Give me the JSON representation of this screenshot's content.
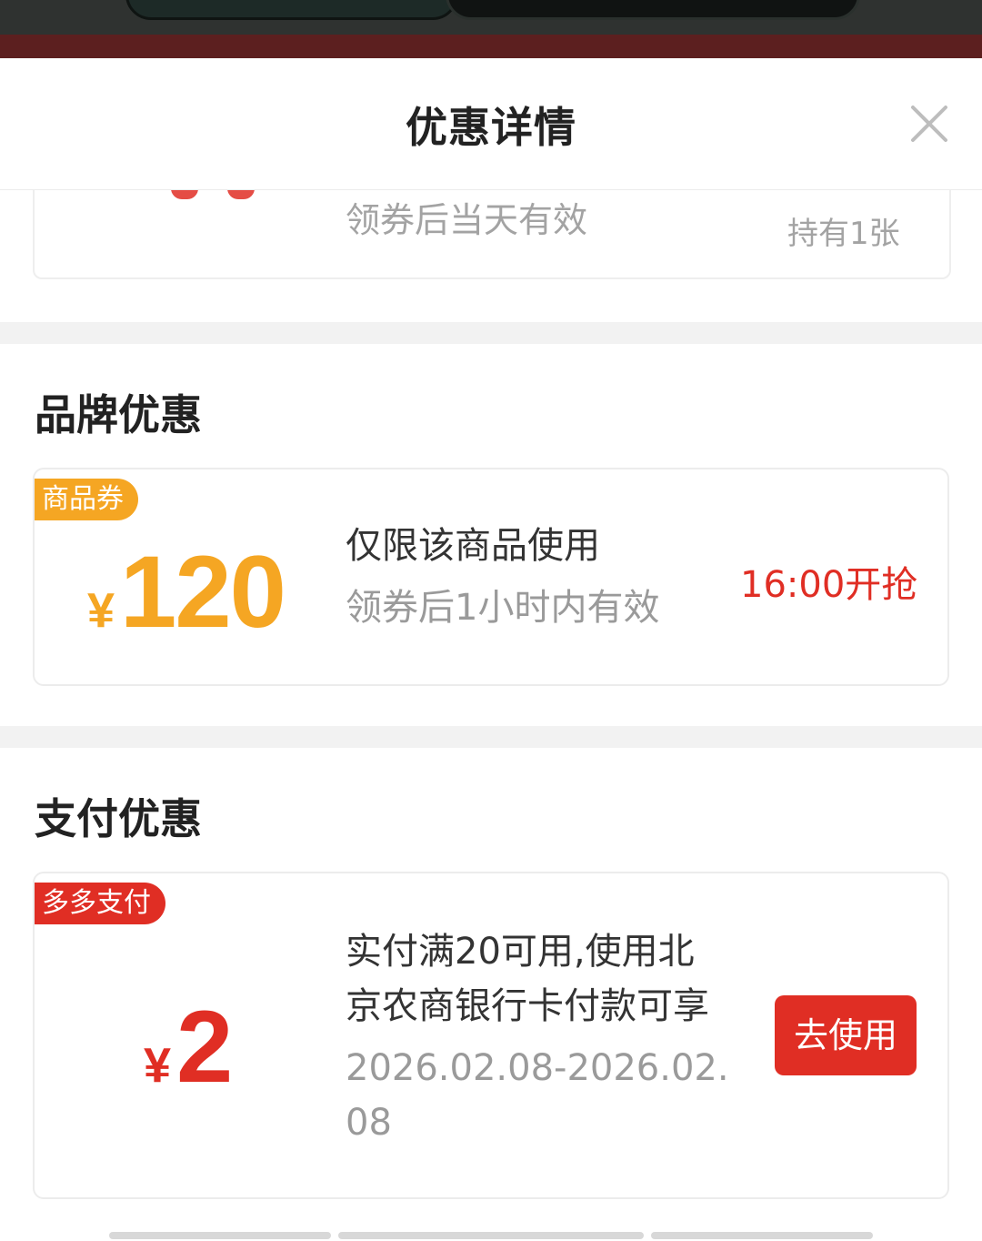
{
  "header": {
    "title": "优惠详情"
  },
  "previous_coupon": {
    "validity": "领券后当天有效",
    "holding": "持有1张"
  },
  "brand_section": {
    "title": "品牌优惠",
    "coupon": {
      "tag": "商品券",
      "currency": "¥",
      "amount": "120",
      "condition": "仅限该商品使用",
      "validity": "领券后1小时内有效",
      "action": "16:00开抢"
    }
  },
  "payment_section": {
    "title": "支付优惠",
    "coupon": {
      "tag": "多多支付",
      "currency": "¥",
      "amount": "2",
      "condition_line1": "实付满20可用,使用北",
      "condition_line2": "京农商银行卡付款可享",
      "validity_line1": "2026.02.08-2026.02.",
      "validity_line2": "08",
      "action": "去使用"
    }
  },
  "colors": {
    "accent_red": "#e02e24",
    "brand_orange": "#f5a623",
    "muted_gray": "#9a9a9a"
  },
  "icons": {
    "close": "close-icon"
  }
}
